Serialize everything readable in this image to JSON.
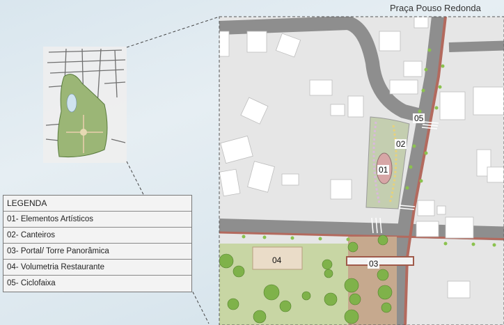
{
  "plan_title": "Praça Pouso Redonda",
  "legend": {
    "title": "LEGENDA",
    "items": [
      "01- Elementos Artísticos",
      "02- Canteiros",
      "03- Portal/ Torre Panorâmica",
      "04- Volumetria Restaurante",
      "05- Ciclofaixa"
    ]
  },
  "markers": {
    "m01": "01",
    "m02": "02",
    "m03": "03",
    "m04": "04",
    "m05": "05"
  },
  "colors": {
    "road": "#8e8e8e",
    "lot": "#e7e7e7",
    "grass": "#c8d6a4",
    "bike_lane": "#b36a5e",
    "tree": "#7fb24a",
    "building": "#ffffff"
  }
}
